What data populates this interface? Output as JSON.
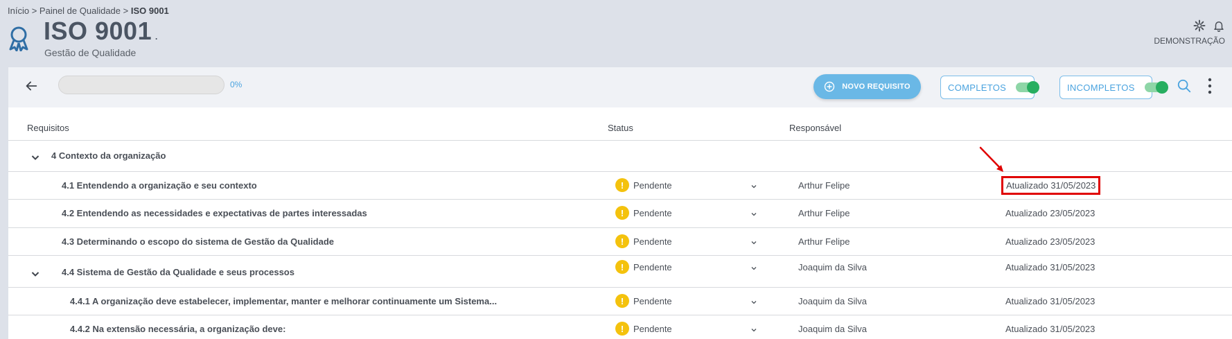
{
  "breadcrumb": {
    "home": "Início",
    "sep": ">",
    "panel": "Painel de Qualidade",
    "current": "ISO 9001"
  },
  "header": {
    "title": "ISO 9001",
    "title_suffix": ".",
    "subtitle": "Gestão de Qualidade",
    "user": "DEMONSTRAÇÃO"
  },
  "toolbar": {
    "progress_label": "0%",
    "progress_value": 0,
    "new_button": "NOVO REQUISITO",
    "completos": "COMPLETOS",
    "incompletos": "INCOMPLETOS"
  },
  "table": {
    "headers": {
      "requisitos": "Requisitos",
      "status": "Status",
      "responsavel": "Responsável"
    },
    "group": "4 Contexto da organização",
    "rows": [
      {
        "req": "4.1 Entendendo a organização e seu contexto",
        "status": "Pendente",
        "resp": "Arthur Felipe",
        "updated": "Atualizado 31/05/2023"
      },
      {
        "req": "4.2 Entendendo as necessidades e expectativas de partes interessadas",
        "status": "Pendente",
        "resp": "Arthur Felipe",
        "updated": "Atualizado 23/05/2023"
      },
      {
        "req": "4.3 Determinando o escopo do sistema de Gestão da Qualidade",
        "status": "Pendente",
        "resp": "Arthur Felipe",
        "updated": "Atualizado 23/05/2023"
      },
      {
        "req": "4.4 Sistema de Gestão da Qualidade e seus processos",
        "status": "Pendente",
        "resp": "Joaquim da Silva",
        "updated": "Atualizado 31/05/2023"
      },
      {
        "req": "4.4.1 A organização deve estabelecer, implementar, manter e melhorar continuamente um Sistema...",
        "status": "Pendente",
        "resp": "Joaquim da Silva",
        "updated": "Atualizado 31/05/2023"
      },
      {
        "req": "4.4.2 Na extensão necessária, a organização deve:",
        "status": "Pendente",
        "resp": "Joaquim da Silva",
        "updated": "Atualizado 31/05/2023"
      }
    ]
  },
  "colors": {
    "accent": "#4aa3df",
    "button": "#6ab8e6",
    "toggle_on": "#27ae60",
    "warning": "#f4c20d",
    "annotation": "#e00000"
  },
  "icons": [
    "award-icon",
    "gear-icon",
    "bell-icon",
    "back-arrow-icon",
    "plus-circle-icon",
    "search-icon",
    "more-vertical-icon",
    "chevron-down-icon",
    "warning-icon",
    "annotation-arrow-icon"
  ]
}
